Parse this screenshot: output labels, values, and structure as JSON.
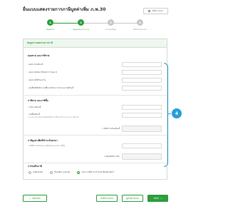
{
  "header": {
    "title": "ยื่นแบบแสดงรายการภาษีมูลค่าเพิ่ม ภ.พ.30",
    "draft_button": "บันทึกร่างแบบ"
  },
  "stepper": {
    "steps": [
      {
        "num": "1",
        "label": "ข้อมูลทั่วไป"
      },
      {
        "num": "2",
        "label": "ข้อมูลแสดงรายการภาษี"
      },
      {
        "num": "3",
        "label": "ตรวจสอบข้อมูล"
      },
      {
        "num": "4",
        "label": "ยืนยันการชำระภาษี"
      }
    ],
    "active_index": 1,
    "active_color": "#2e9e3e",
    "inactive_color": "#c8c8c8"
  },
  "card": {
    "title": "ข้อมูลการแสดงรายการภาษี"
  },
  "sales": {
    "title": "ยอดขาย และภาษีขาย",
    "rows": [
      {
        "label": "ยอดขายในเดือนนี้"
      },
      {
        "label": "ยอดขายที่เสียภาษีในอัตรา ร้อยละ 0"
      },
      {
        "label": "ยอดขายที่ได้รับยกเว้น"
      },
      {
        "label": "ยอดซื้อที่มีสิทธินำภาษีซื้อมาหักในการคำนวณภาษีเดือนนี้"
      }
    ]
  },
  "purchase": {
    "title": "ภาษีขาย และภาษีซื้อ",
    "rows": [
      {
        "label": "ภาษีขายเดือนนี้",
        "sub": ""
      },
      {
        "label": "ภาษีซื้อเดือนนี้",
        "sub": "(ตามใบกำกับภาษีของยอดซื้อที่มีสิทธินำภาษีซื้อมาหักในการคำนวณภาษีเดือนนี้)"
      }
    ],
    "total_label": "ภาษีที่ชำระเกินเดือนนี้"
  },
  "carry": {
    "title": "ภาษีมูลค่าเพิ่มที่ชำระเกินยกมา",
    "sub": "ภาษีที่ชำระเกินยกมาจากเดือนก่อน (มาตรา 78/4)",
    "total_label": "ภาษีสุทธิที่ชำระเกิน"
  },
  "refund": {
    "title": "การขอคืนภาษี",
    "options": [
      {
        "label": "ขอคืนเงินสด",
        "selected": false
      },
      {
        "label": "ยื่นขอคืนแบบเงินสด",
        "selected": false
      },
      {
        "label": "ขอนำภาษีที่ชำระเกินไปเครดิตเดือนถัดไป",
        "selected": true
      }
    ]
  },
  "annotation": {
    "badge": "4",
    "color": "#2a9fd6"
  },
  "footer": {
    "back_label": "ย้อนกลับ",
    "save_label": "บันทึกร่างแบบ",
    "preview_label": "ดูตัวอย่างแบบ",
    "next_label": "ถัดไป"
  }
}
